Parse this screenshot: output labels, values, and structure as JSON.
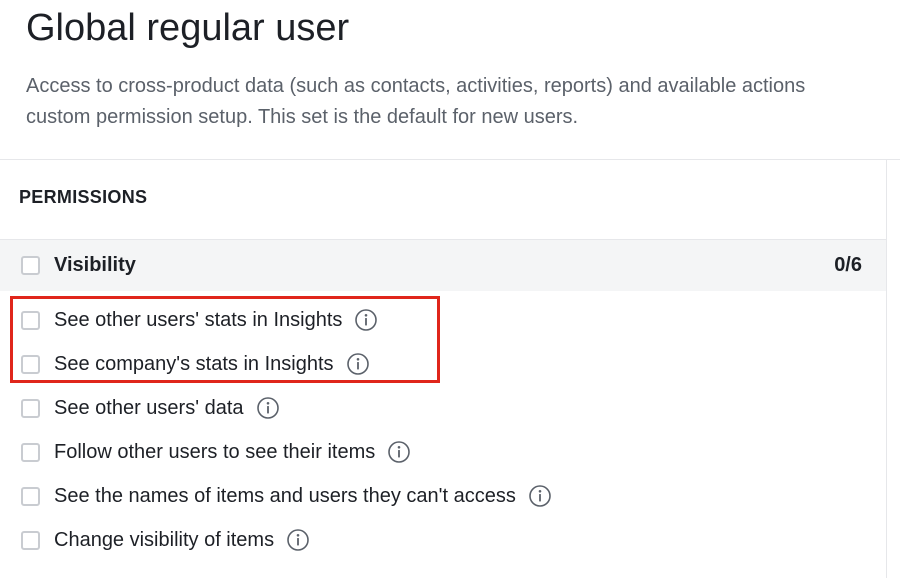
{
  "page": {
    "title": "Global regular user",
    "description_lines": [
      "Access to cross-product data (such as contacts, activities, reports) and available actions",
      "custom permission setup. This set is the default for new users."
    ]
  },
  "permissions": {
    "heading": "PERMISSIONS",
    "group": {
      "label": "Visibility",
      "count": "0/6",
      "checked": false
    },
    "items": [
      {
        "label": "See other users' stats in Insights",
        "checked": false,
        "has_info": true,
        "info_icon": "info-circle-icon"
      },
      {
        "label": "See company's stats in Insights",
        "checked": false,
        "has_info": true,
        "info_icon": "info-circle-icon"
      },
      {
        "label": "See other users' data",
        "checked": false,
        "has_info": true,
        "info_icon": "info-circle-icon"
      },
      {
        "label": "Follow other users to see their items",
        "checked": false,
        "has_info": true,
        "info_icon": "info-circle-icon"
      },
      {
        "label": "See the names of items and users they can't access",
        "checked": false,
        "has_info": true,
        "info_icon": "info-circle-icon"
      },
      {
        "label": "Change visibility of items",
        "checked": false,
        "has_info": true,
        "info_icon": "info-circle-icon"
      }
    ]
  },
  "annotation": {
    "highlight_color": "#e0261b",
    "highlighted_items": [
      0,
      1
    ]
  },
  "colors": {
    "text_primary": "#1d2026",
    "text_secondary": "#5b616a",
    "group_background": "#f4f5f6",
    "checkbox_border": "#c9ccd1",
    "divider": "#e6e7ea"
  }
}
